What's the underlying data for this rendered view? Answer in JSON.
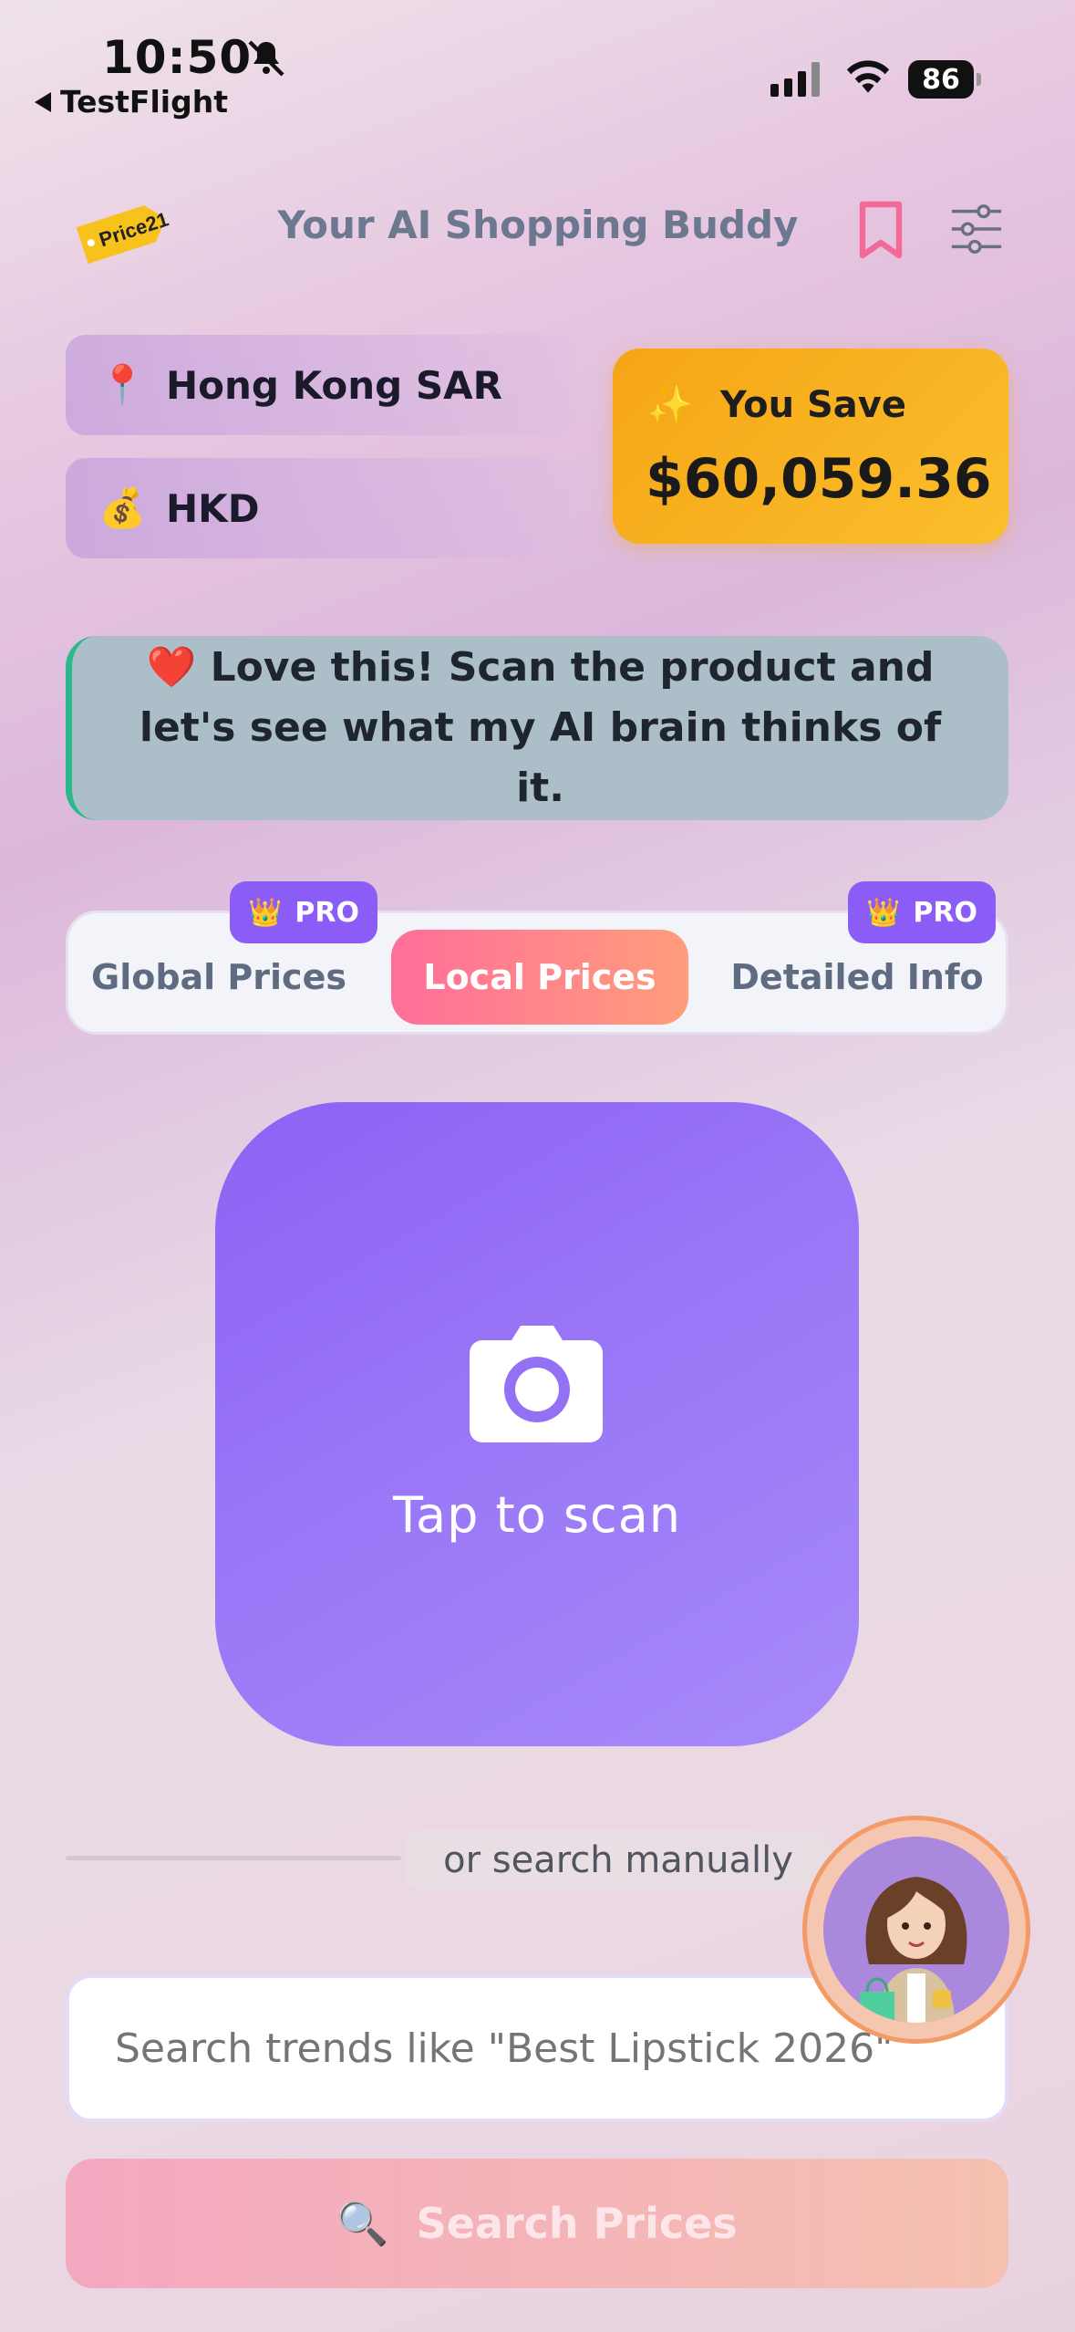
{
  "status_bar": {
    "time": "10:50",
    "back_app": "TestFlight",
    "battery": "86"
  },
  "header": {
    "logo_text": "Price21",
    "title": "Your AI Shopping Buddy"
  },
  "location": {
    "icon": "📍",
    "label": "Hong Kong SAR"
  },
  "currency": {
    "icon": "💰",
    "label": "HKD"
  },
  "savings": {
    "icon": "✨",
    "label": "You Save",
    "amount": "$60,059.36"
  },
  "message": {
    "text": "❤️ Love this! Scan the product and let's see what my AI brain thinks of it."
  },
  "tabs": {
    "items": [
      {
        "label": "Global Prices",
        "pro": true
      },
      {
        "label": "Local Prices",
        "active": true
      },
      {
        "label": "Detailed Info",
        "pro": true
      }
    ],
    "pro_icon": "👑",
    "pro_label": "PRO"
  },
  "scan": {
    "label": "Tap to scan"
  },
  "divider": {
    "text": "or search manually"
  },
  "search": {
    "placeholder": "Search trends like \"Best Lipstick 2026\""
  },
  "search_button": {
    "icon": "🔍",
    "label": "Search Prices"
  },
  "colors": {
    "accent_purple": "#8b5cf6",
    "active_tab": "#ff6e9a",
    "savings": "#f5a516",
    "message_border": "#2bb88a"
  }
}
